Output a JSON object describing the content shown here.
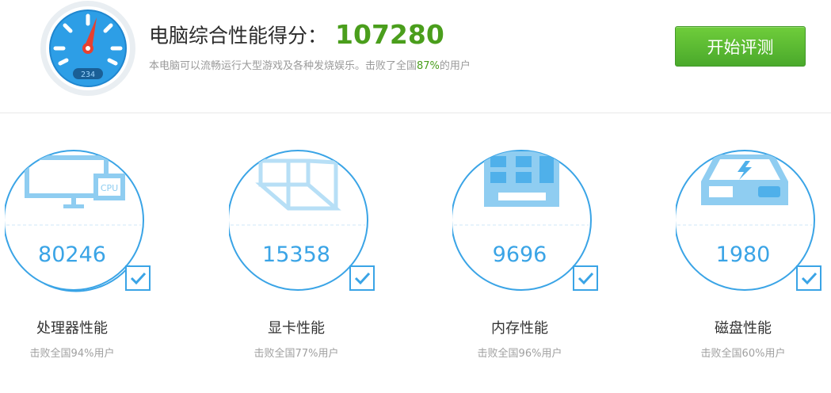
{
  "header": {
    "title": "电脑综合性能得分：",
    "score": "107280",
    "subtitle_before": "本电脑可以流畅运行大型游戏及各种发烧娱乐。击败了全国",
    "subtitle_pct": "87%",
    "subtitle_after": "的用户",
    "gauge_readout": "234",
    "start_button": "开始评测"
  },
  "cards": [
    {
      "name": "处理器性能",
      "value": "80246",
      "beat": "击败全国94%用户",
      "icon": "cpu-monitor-icon",
      "chip_label": "CPU"
    },
    {
      "name": "显卡性能",
      "value": "15358",
      "beat": "击败全国77%用户",
      "icon": "graphics-cube-icon"
    },
    {
      "name": "内存性能",
      "value": "9696",
      "beat": "击败全国96%用户",
      "icon": "memory-module-icon"
    },
    {
      "name": "磁盘性能",
      "value": "1980",
      "beat": "击败全国60%用户",
      "icon": "disk-drive-icon"
    }
  ],
  "colors": {
    "accent_blue": "#3aa4e6",
    "score_green": "#4a9e1c",
    "button_green": "#5bbd33"
  }
}
